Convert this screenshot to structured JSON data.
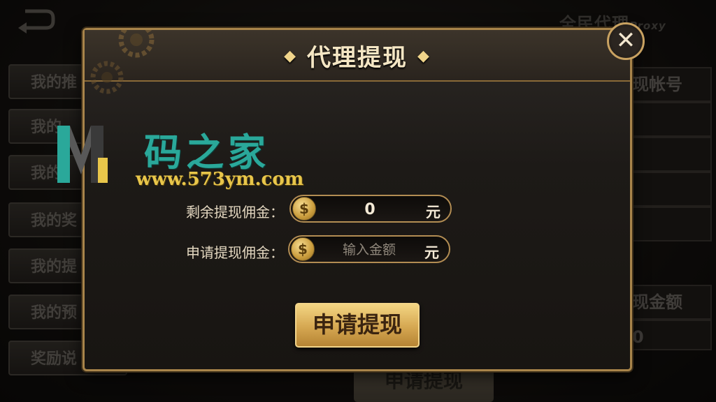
{
  "background": {
    "title": "全民代理",
    "title_suffix": "Proxy",
    "tabs": [
      "我的推",
      "我的",
      "我的",
      "我的奖",
      "我的提",
      "我的预",
      "奖励说"
    ],
    "right_cells": [
      "现帐号",
      "",
      "",
      "",
      "",
      "现金额",
      "0"
    ],
    "bottom_button": "申请提现"
  },
  "dialog": {
    "title": "代理提现",
    "close_label": "✕",
    "remaining": {
      "label": "剩余提现佣金：",
      "value": "0",
      "unit": "元"
    },
    "apply": {
      "label": "申请提现佣金：",
      "placeholder": "输入金额",
      "unit": "元"
    },
    "submit_label": "申请提现",
    "coin_symbol": "$"
  },
  "watermark": {
    "brand": "码之家",
    "url": "www.573ym.com"
  }
}
